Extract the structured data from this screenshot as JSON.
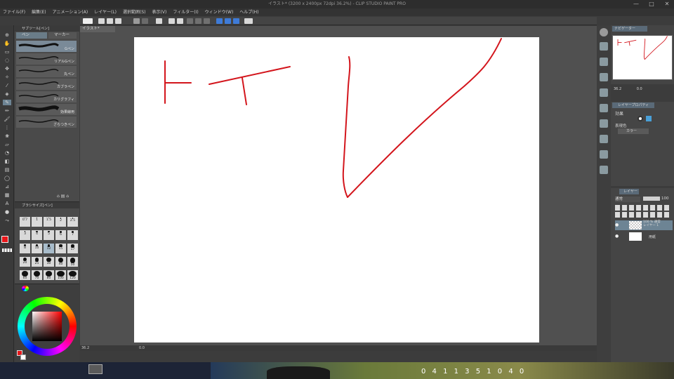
{
  "window": {
    "title": "イラスト* (3200 x 2400px 72dpi 36.2%)  - CLIP STUDIO PAINT PRO",
    "controls": [
      "—",
      "□",
      "✕"
    ]
  },
  "menu": [
    "ファイル(F)",
    "編集(E)",
    "アニメーション(A)",
    "レイヤー(L)",
    "選択範囲(S)",
    "表示(V)",
    "フィルター(I)",
    "ウィンドウ(W)",
    "ヘルプ(H)"
  ],
  "document_tab": "イラスト*",
  "subtool": {
    "panel_tab": "サブツール[ペン]",
    "tabs": [
      "ペン",
      "マーカー"
    ],
    "brushes": [
      {
        "label": "Gペン",
        "selected": true
      },
      {
        "label": "リアルGペン",
        "selected": false
      },
      {
        "label": "丸ペン",
        "selected": false
      },
      {
        "label": "カブラペン",
        "selected": false
      },
      {
        "label": "カリグラフィ",
        "selected": false
      },
      {
        "label": "効果線用",
        "selected": false
      },
      {
        "label": "ざらつきペン",
        "selected": false
      }
    ]
  },
  "brush_size": {
    "panel_tab": "ブラシサイズ[ペン]",
    "sizes": [
      "0.7",
      "1",
      "1.5",
      "2",
      "2.5",
      "3",
      "4",
      "5",
      "6",
      "7",
      "8",
      "10",
      "12",
      "15",
      "17",
      "20",
      "25",
      "30",
      "40",
      "50",
      "60",
      "70",
      "80",
      "100",
      "120"
    ],
    "selected": "12"
  },
  "colors": {
    "main": "#e8161a",
    "sub": "#ffffff",
    "stroke": "#d3151c",
    "paper": "#ffffff"
  },
  "status": {
    "zoom": "36.2",
    "angle": "0.0"
  },
  "navigator": {
    "tab": "ナビゲーター",
    "zoom": "36.2",
    "angle": "0.0"
  },
  "layer_property": {
    "tab": "レイヤープロパティ",
    "effect_label": "効果",
    "color_label": "表現色",
    "color_value": "カラー"
  },
  "layers": {
    "tab": "レイヤー",
    "blend_mode": "通常",
    "opacity": "100",
    "items": [
      {
        "name": "100 % 通常\nレイヤー 1",
        "selected": true
      },
      {
        "name": "用紙",
        "selected": false
      }
    ]
  },
  "taskbar_text": "0 4 1   1 3 5 1 0   4 0"
}
